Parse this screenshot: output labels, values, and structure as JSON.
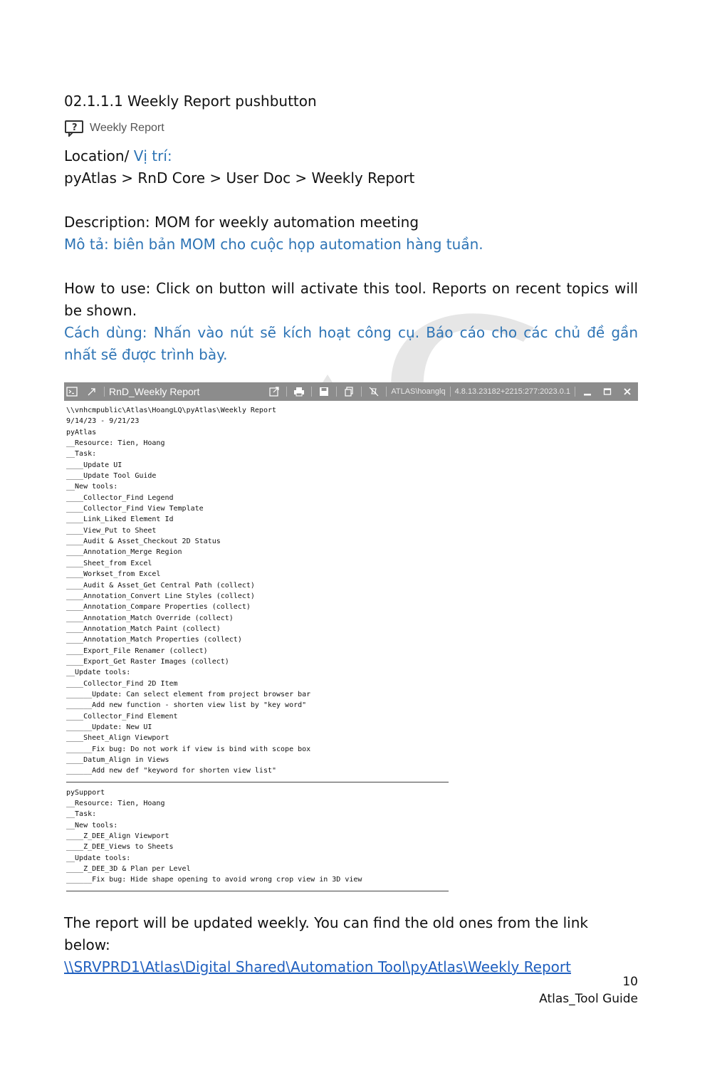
{
  "heading": "02.1.1.1 Weekly Report pushbutton",
  "button": {
    "icon": "help-dialog-icon",
    "label": "Weekly Report"
  },
  "location": {
    "label": "Location/ ",
    "label_vi": "Vị trí:",
    "path": "pyAtlas > RnD Core > User Doc > Weekly Report"
  },
  "description": {
    "en": "Description: MOM for weekly automation meeting",
    "vi": "Mô tả: biên bản MOM cho cuộc họp automation hàng tuần."
  },
  "how_to_use": {
    "en": "How to use: Click on button will activate this tool. Reports on recent topics will be shown.",
    "vi": "Cách dùng: Nhấn vào nút sẽ kích hoạt công cụ. Báo cáo cho các chủ đề gần nhất sẽ được trình bày."
  },
  "window": {
    "title": "RnD_Weekly Report",
    "user": "ATLAS\\hoanglq",
    "version": "4.8.13.23182+2215:277:2023.0.1",
    "icons": [
      "console-icon",
      "pin-icon",
      "open-external-icon",
      "print-icon",
      "save-icon",
      "copy-icon",
      "mute-icon",
      "minimize-icon",
      "maximize-icon",
      "close-icon"
    ]
  },
  "report_lines_1": [
    "\\\\vnhcmpublic\\Atlas\\HoangLQ\\pyAtlas\\Weekly Report",
    "9/14/23 - 9/21/23",
    "pyAtlas",
    "__Resource: Tien, Hoang",
    "__Task:",
    "____Update UI",
    "____Update Tool Guide",
    "__New tools:",
    "____Collector_Find Legend",
    "____Collector_Find View Template",
    "____Link_Liked Element Id",
    "____View_Put to Sheet",
    "____Audit & Asset_Checkout 2D Status",
    "____Annotation_Merge Region",
    "____Sheet_from Excel",
    "____Workset_from Excel",
    "____Audit & Asset_Get Central Path (collect)",
    "____Annotation_Convert Line Styles (collect)",
    "____Annotation_Compare Properties (collect)",
    "____Annotation_Match Override (collect)",
    "____Annotation_Match Paint (collect)",
    "____Annotation_Match Properties (collect)",
    "____Export_File Renamer (collect)",
    "____Export_Get Raster Images (collect)",
    "__Update tools:",
    "____Collector_Find 2D Item",
    "______Update: Can select element from project browser bar",
    "______Add new function - shorten view list by \"key word\"",
    "____Collector_Find Element",
    "______Update: New UI",
    "____Sheet_Align Viewport",
    "______Fix bug: Do not work if view is bind with scope box",
    "____Datum_Align in Views",
    "______Add new def \"keyword for shorten view list\""
  ],
  "report_lines_2": [
    "pySupport",
    "__Resource: Tien, Hoang",
    "__Task:",
    "__New tools:",
    "____Z_DEE_Align Viewport",
    "____Z_DEE_Views to Sheets",
    "__Update tools:",
    "____Z_DEE_3D & Plan per Level",
    "______Fix bug: Hide shape opening to avoid wrong crop view in 3D view"
  ],
  "closing": {
    "text": "The report will be updated weekly. You can find the old ones from the link below:",
    "link": "\\\\SRVPRD1\\Atlas\\Digital Shared\\Automation Tool\\pyAtlas\\Weekly Report"
  },
  "footer": {
    "page_number": "10",
    "doc_name": "Atlas_Tool Guide"
  }
}
